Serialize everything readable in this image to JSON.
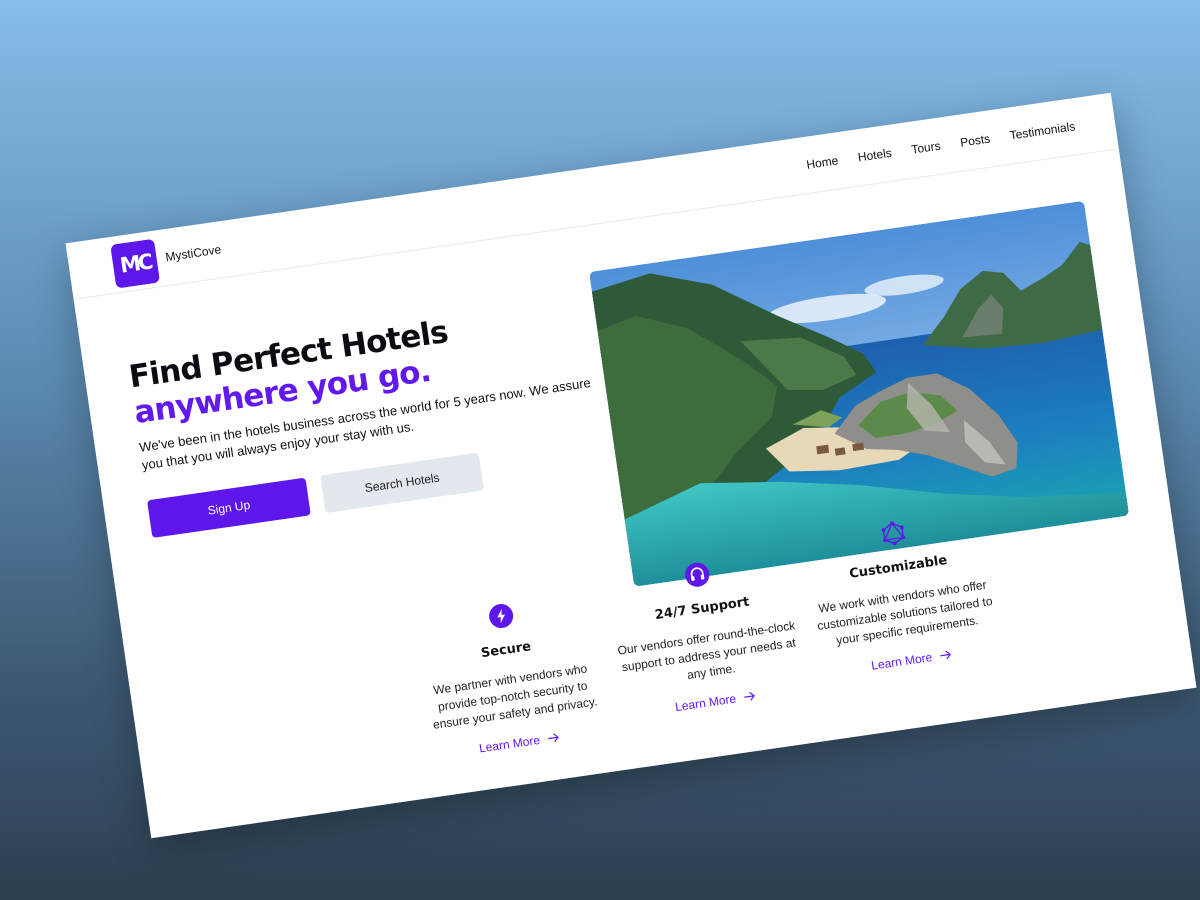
{
  "brand": {
    "logo_text": "MC",
    "name": "MystiCove",
    "accent": "#5d17eb"
  },
  "nav": {
    "items": [
      {
        "label": "Home"
      },
      {
        "label": "Hotels"
      },
      {
        "label": "Tours"
      },
      {
        "label": "Posts"
      },
      {
        "label": "Testimonials"
      }
    ]
  },
  "hero": {
    "title_line1": "Find Perfect Hotels",
    "title_line2": "anywhere you go.",
    "description": "We've been in the hotels business across the world for 5 years now. We assure you that you will always enjoy your stay with us.",
    "primary_button": "Sign Up",
    "secondary_button": "Search Hotels",
    "image_subject": "tropical island lagoon photo"
  },
  "features": [
    {
      "icon": "lightning-bolt-icon",
      "title": "Secure",
      "description": "We partner with vendors who provide top-notch security to ensure your safety and privacy.",
      "link": "Learn More"
    },
    {
      "icon": "headphones-icon",
      "title": "24/7 Support",
      "description": "Our vendors offer round-the-clock support to address your needs at any time.",
      "link": "Learn More"
    },
    {
      "icon": "network-graph-icon",
      "title": "Customizable",
      "description": "We work with vendors who offer customizable solutions tailored to your specific requirements.",
      "link": "Learn More"
    }
  ]
}
